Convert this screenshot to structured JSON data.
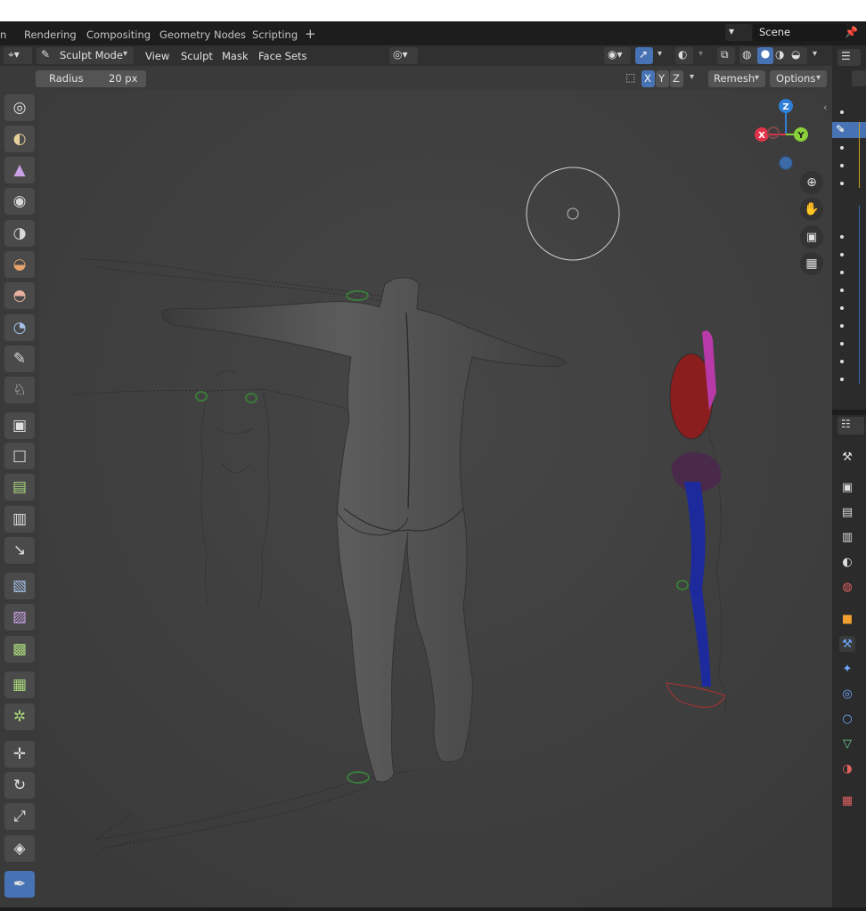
{
  "tabs": [
    "n",
    "Rendering",
    "Compositing",
    "Geometry Nodes",
    "Scripting",
    "+"
  ],
  "scene": {
    "label": "Scene"
  },
  "header": {
    "mode_label": "Sculpt Mode",
    "menus": [
      "View",
      "Sculpt",
      "Mask",
      "Face Sets"
    ]
  },
  "toolsettings": {
    "radius_label": "Radius",
    "radius_value": "20 px",
    "axis_x": "X",
    "axis_y": "Y",
    "axis_z": "Z",
    "remesh_label": "Remesh",
    "options_label": "Options"
  },
  "gizmo": {
    "z": "Z",
    "x": "X",
    "y": "Y"
  },
  "colors": {
    "accent": "#4772b3",
    "axis_x": "#e0334a",
    "axis_y": "#8ad03a",
    "axis_z": "#2f7fd8"
  },
  "tools": [
    "draw-brush-icon",
    "clay-strips-icon",
    "pinch-icon",
    "smooth-icon",
    "grab-icon",
    "elastic-icon",
    "snake-hook-icon",
    "thumb-icon",
    "mask-brush-icon",
    "draw-face-sets-icon",
    "box-mask-icon",
    "box-hide-icon",
    "box-face-set-icon",
    "box-trim-icon",
    "line-project-icon",
    "mesh-filter-icon",
    "cloth-filter-icon",
    "color-filter-icon",
    "edit-face-set-icon",
    "mask-by-color-icon",
    "move-icon",
    "rotate-icon",
    "scale-icon",
    "transform-icon",
    "annotate-icon"
  ]
}
